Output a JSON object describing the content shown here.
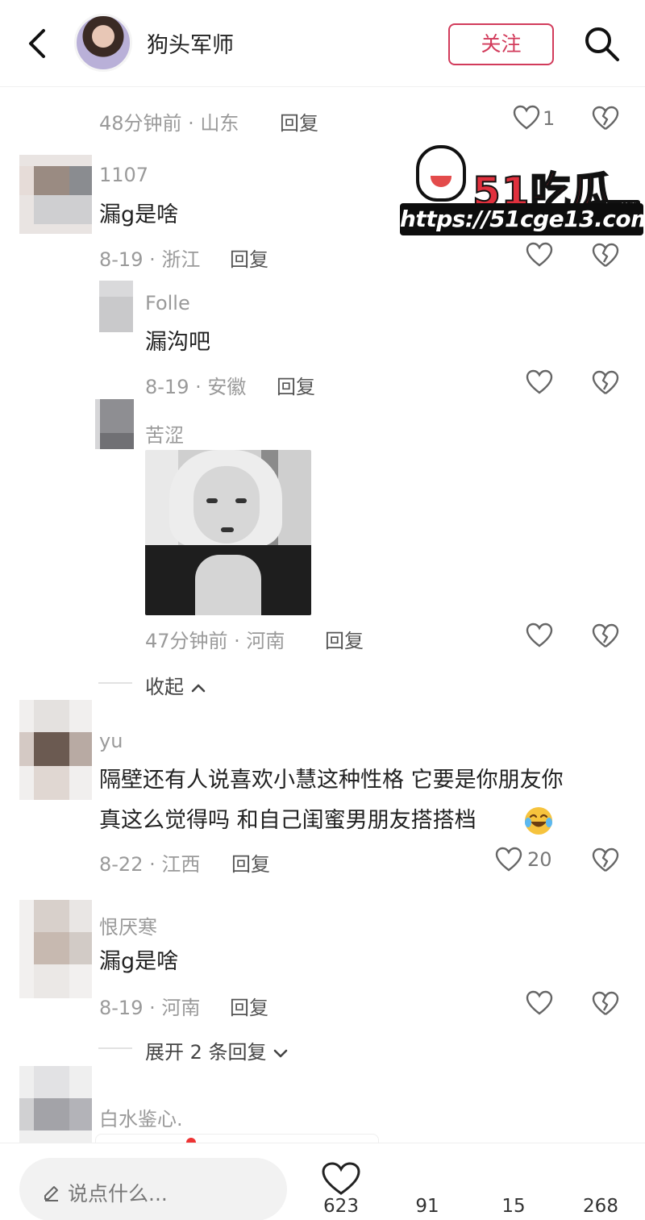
{
  "header": {
    "user_name": "狗头军师",
    "follow_label": "关注"
  },
  "comments": [
    {
      "meta": "48分钟前 · 山东",
      "reply_label": "回复",
      "likes": "1"
    },
    {
      "username": "1107",
      "text": "漏g是啥",
      "meta": "8-19 · 浙江",
      "reply_label": "回复"
    },
    {
      "username": "Folle",
      "text": "漏沟吧",
      "meta": "8-19 · 安徽",
      "reply_label": "回复"
    },
    {
      "username": "苦涩",
      "meta": "47分钟前 · 河南",
      "reply_label": "回复"
    },
    {
      "username": "yu",
      "text_line1": "隔壁还有人说喜欢小慧这种性格 它要是你朋友你",
      "text_line2": "真这么觉得吗 和自己闺蜜男朋友搭搭档",
      "meta": "8-22 · 江西",
      "reply_label": "回复",
      "likes": "20"
    },
    {
      "username": "恨厌寒",
      "text": "漏g是啥",
      "meta": "8-19 · 河南",
      "reply_label": "回复"
    },
    {
      "username": "白水鉴心."
    }
  ],
  "collapse_label": "收起",
  "expand_label": "展开 2 条回复",
  "watermark": {
    "brand": "51吃瓜",
    "tag": "全网首发",
    "url": "https://51cge13.com"
  },
  "bottom_bar": {
    "input_placeholder": "说点什么...",
    "likes": "623",
    "stars": "91",
    "comments": "15",
    "shares": "268"
  },
  "colors": {
    "accent": "#d23b5b",
    "meta_gray": "#9a9a9a"
  },
  "icons": [
    "back-icon",
    "search-icon",
    "heart-icon",
    "broken-heart-icon",
    "chevron-up-icon",
    "chevron-down-icon",
    "pencil-icon",
    "laughing-emoji-icon"
  ]
}
